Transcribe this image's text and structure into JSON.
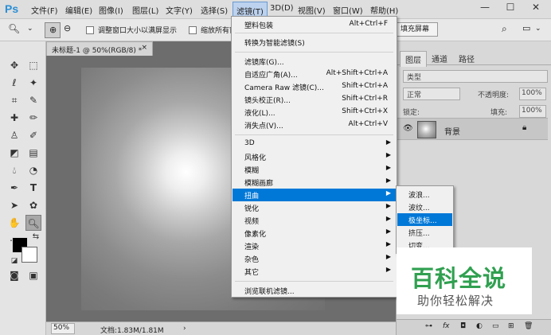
{
  "app": {
    "logo": "Ps"
  },
  "menubar": {
    "items": [
      "文件(F)",
      "编辑(E)",
      "图像(I)",
      "图层(L)",
      "文字(Y)",
      "选择(S)",
      "滤镜(T)",
      "3D(D)",
      "视图(V)",
      "窗口(W)",
      "帮助(H)"
    ],
    "active": "滤镜(T)"
  },
  "window_controls": {
    "minimize": "—",
    "maximize": "☐",
    "close": "✕"
  },
  "options_bar": {
    "resize_window_label": "调整窗口大小以满屏显示",
    "zoom_all_label": "缩放所有窗",
    "fill_screen_label": "填充屏幕"
  },
  "document": {
    "tab_title": "未标题-1 @ 50%(RGB/8) *",
    "close": "×",
    "zoom": "50%",
    "doc_info": "文档:1.83M/1.81M"
  },
  "layers_panel": {
    "tabs": [
      "图层",
      "通道",
      "路径"
    ],
    "active_tab": "图层",
    "filter_kind": "类型",
    "blend_mode": "正常",
    "opacity_label": "不透明度:",
    "opacity_value": "100%",
    "lock_label": "锁定:",
    "fill_label": "填充:",
    "fill_value": "100%",
    "layer_name": "背景"
  },
  "filter_menu": {
    "items": [
      {
        "label": "塑料包装",
        "shortcut": "Alt+Ctrl+F"
      },
      {
        "label": "转换为智能滤镜(S)",
        "shortcut": ""
      },
      {
        "label": "滤镜库(G)...",
        "shortcut": ""
      },
      {
        "label": "自适应广角(A)...",
        "shortcut": "Alt+Shift+Ctrl+A"
      },
      {
        "label": "Camera Raw 滤镜(C)...",
        "shortcut": "Shift+Ctrl+A"
      },
      {
        "label": "镜头校正(R)...",
        "shortcut": "Shift+Ctrl+R"
      },
      {
        "label": "液化(L)...",
        "shortcut": "Shift+Ctrl+X"
      },
      {
        "label": "消失点(V)...",
        "shortcut": "Alt+Ctrl+V"
      },
      {
        "label": "3D",
        "submenu": true
      },
      {
        "label": "风格化",
        "submenu": true
      },
      {
        "label": "模糊",
        "submenu": true
      },
      {
        "label": "模糊画廊",
        "submenu": true
      },
      {
        "label": "扭曲",
        "submenu": true,
        "highlighted": true
      },
      {
        "label": "锐化",
        "submenu": true
      },
      {
        "label": "视频",
        "submenu": true
      },
      {
        "label": "像素化",
        "submenu": true
      },
      {
        "label": "渲染",
        "submenu": true
      },
      {
        "label": "杂色",
        "submenu": true
      },
      {
        "label": "其它",
        "submenu": true
      },
      {
        "label": "浏览联机滤镜...",
        "shortcut": ""
      }
    ]
  },
  "distort_submenu": {
    "items": [
      "波浪...",
      "波纹...",
      "极坐标...",
      "挤压...",
      "切变..."
    ],
    "highlighted": "极坐标..."
  },
  "watermark": {
    "title": "百科全说",
    "subtitle": "助你轻松解决"
  },
  "colors": {
    "menu_highlight": "#0078d7",
    "ps_blue": "#2b8fd6",
    "watermark_green": "#30a050"
  }
}
